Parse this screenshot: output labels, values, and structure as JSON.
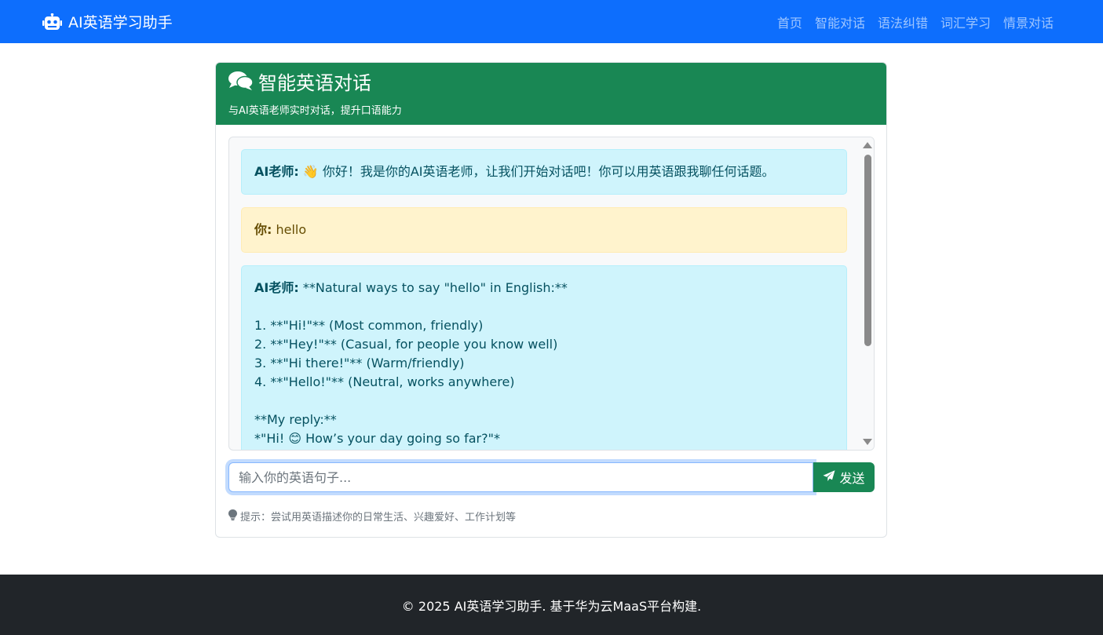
{
  "colors": {
    "navbar": "#0d6efd",
    "card_header": "#198754",
    "ai_message_bg": "#cff4fc",
    "user_message_bg": "#fff3cd",
    "footer": "#212529"
  },
  "navbar": {
    "brand_icon": "robot-icon",
    "brand": "AI英语学习助手",
    "links": [
      "首页",
      "智能对话",
      "语法纠错",
      "词汇学习",
      "情景对话"
    ]
  },
  "card": {
    "title_icon": "comments-icon",
    "title": "智能英语对话",
    "subtitle": "与AI英语老师实时对话，提升口语能力"
  },
  "messages": [
    {
      "role": "ai",
      "who": "AI老师:",
      "text": "👋 你好！我是你的AI英语老师，让我们开始对话吧！你可以用英语跟我聊任何话题。"
    },
    {
      "role": "user",
      "who": "你:",
      "text": "hello"
    },
    {
      "role": "ai",
      "who": "AI老师:",
      "text": "**Natural ways to say \"hello\" in English:**\n\n1. **\"Hi!\"** (Most common, friendly)\n2. **\"Hey!\"** (Casual, for people you know well)\n3. **\"Hi there!\"** (Warm/friendly)\n4. **\"Hello!\"** (Neutral, works anywhere)\n\n**My reply:**\n*\"Hi! 😊 How’s your day going so far?\"*"
    }
  ],
  "input": {
    "placeholder": "输入你的英语句子...",
    "value": "",
    "send_icon": "paper-plane-icon",
    "send_label": "发送"
  },
  "hint": {
    "icon": "lightbulb-icon",
    "text": "提示：尝试用英语描述你的日常生活、兴趣爱好、工作计划等"
  },
  "footer": {
    "text": "© 2025 AI英语学习助手. 基于华为云MaaS平台构建."
  }
}
